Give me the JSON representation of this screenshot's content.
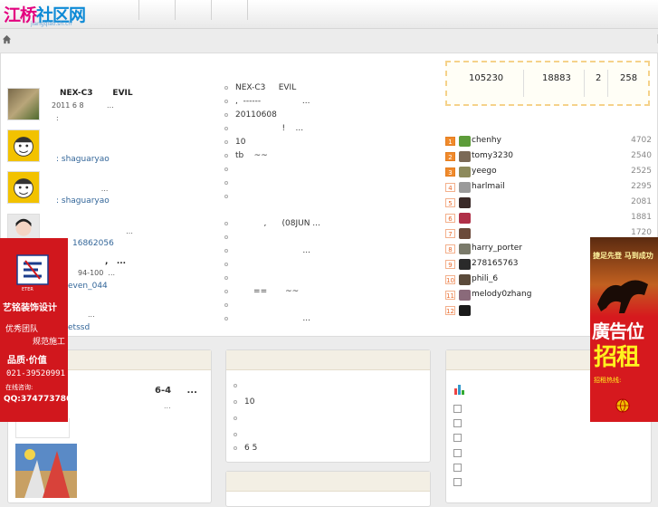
{
  "logo": {
    "text_a": "江桥",
    "text_b": "社区网",
    "domain": "jiangqiao.sh.cn"
  },
  "left_posts": [
    {
      "title": "NEX-C3       EVIL",
      "meta": "2011 6 8          ...",
      "meta2": ":",
      "user": ""
    },
    {
      "title": "",
      "meta": "",
      "meta2": "",
      "user": ": shaguaryao"
    },
    {
      "title": "",
      "meta": "                  ...",
      "meta2": "",
      "user": ": shaguaryao"
    },
    {
      "title": "",
      "meta": "                 ...",
      "meta2": "",
      "user": "16862056"
    },
    {
      "title": ",   ...",
      "meta": "94-100  ...",
      "meta2": "",
      "user": "even_044"
    },
    {
      "title": "",
      "meta": "...",
      "meta2": "",
      "user": "etssd"
    }
  ],
  "mid_list": [
    "NEX-C3     EVIL",
    ",  ------                ...",
    "20110608",
    "                  !    ...",
    "10",
    "tb    ~~",
    "",
    "",
    "",
    "           ,      (08JUN ...",
    "",
    "                          ...",
    "",
    "",
    "       ==       ~~",
    "",
    "                          ..."
  ],
  "stats": [
    "105230",
    "18883",
    "2",
    "258"
  ],
  "ranking": [
    {
      "num": "1",
      "name": "chenhy",
      "count": "4702"
    },
    {
      "num": "2",
      "name": "tomy3230",
      "count": "2540"
    },
    {
      "num": "3",
      "name": "yeego",
      "count": "2525"
    },
    {
      "num": "4",
      "name": "harlmail",
      "count": "2295"
    },
    {
      "num": "5",
      "name": "",
      "count": "2081"
    },
    {
      "num": "6",
      "name": "",
      "count": "1881"
    },
    {
      "num": "7",
      "name": "",
      "count": "1720"
    },
    {
      "num": "8",
      "name": "harry_porter",
      "count": ""
    },
    {
      "num": "9",
      "name": "278165763",
      "count": ""
    },
    {
      "num": "10",
      "name": "phili_6",
      "count": ""
    },
    {
      "num": "11",
      "name": "melody0zhang",
      "count": ""
    },
    {
      "num": "12",
      "name": "",
      "count": ""
    }
  ],
  "bottom_left": {
    "headline": "6-4     ...",
    "sub": "..."
  },
  "bottom_mid": {
    "items": [
      "",
      "10",
      "",
      "",
      "6 5"
    ]
  },
  "ad_left": {
    "line1": "艺铭装饰设计",
    "line2": "优秀团队",
    "line3": "规范施工",
    "line4": "品质·价值",
    "phone": "021-39520991",
    "consult": "在线咨询:",
    "qq": "QQ:374773786",
    "brand": "ETER"
  },
  "ad_right": {
    "slogan": "捷足先登 马到成功",
    "big1": "廣告位",
    "big2": "招租",
    "hotline": "招租热线:"
  },
  "colors": {
    "accent": "#e3007f",
    "link": "#336699",
    "ad_red": "#d1171d",
    "rank_top": "#f08a2c"
  }
}
